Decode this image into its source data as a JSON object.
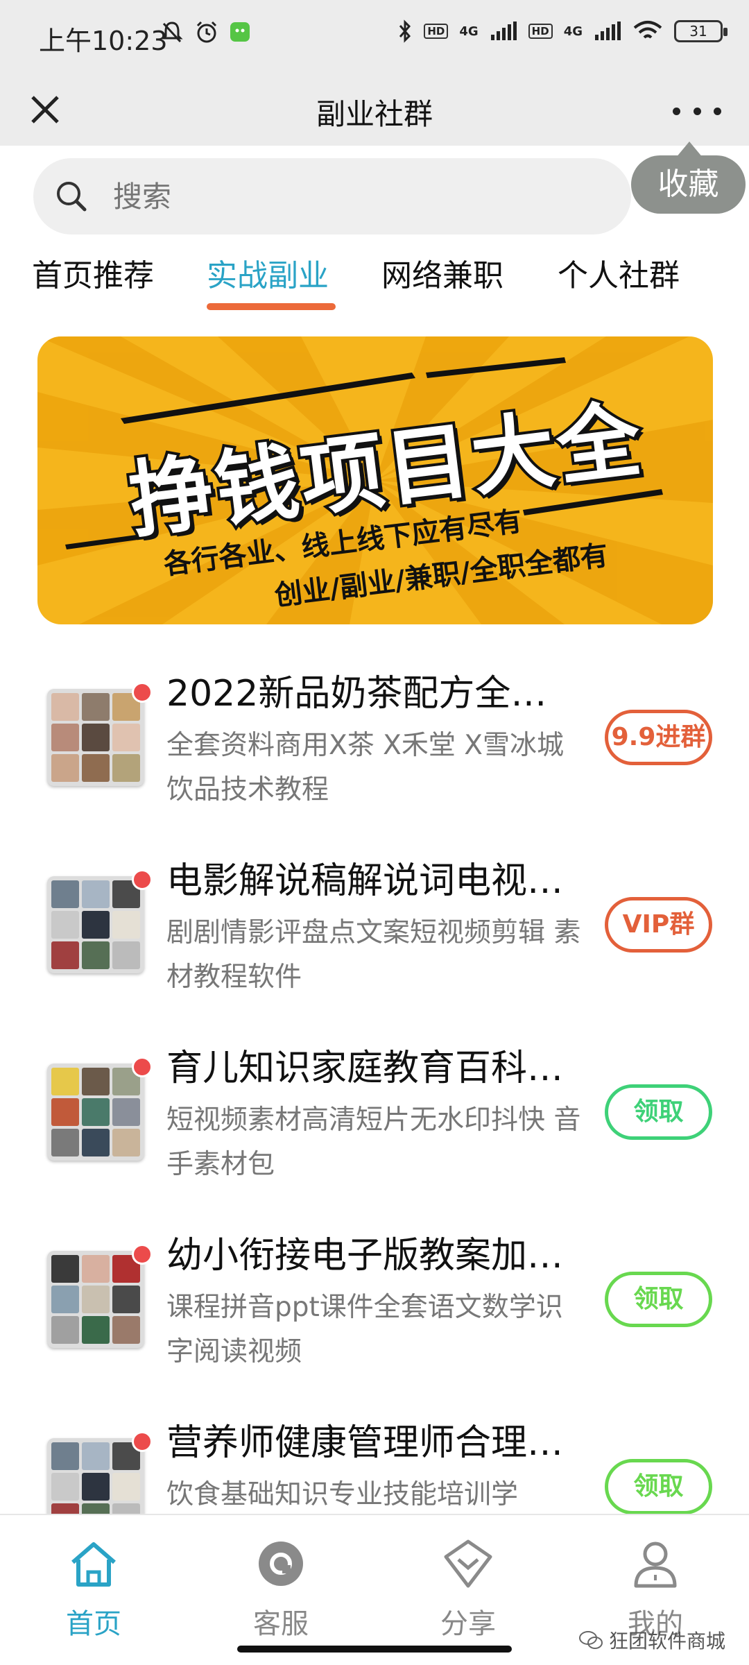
{
  "status_bar": {
    "time": "上午10:23",
    "network_1": "4G",
    "network_2": "4G",
    "hd_1": "HD",
    "hd_2": "HD",
    "battery": "31"
  },
  "header": {
    "title": "副业社群",
    "close_icon": "close-icon",
    "more_icon": "more-icon"
  },
  "search": {
    "placeholder": "搜索",
    "favorite_label": "收藏"
  },
  "tabs": [
    {
      "label": "首页推荐",
      "active": false
    },
    {
      "label": "实战副业",
      "active": true
    },
    {
      "label": "网络兼职",
      "active": false
    },
    {
      "label": "个人社群",
      "active": false
    }
  ],
  "banner": {
    "title": "挣钱项目大全",
    "subtitle_1": "各行各业、线上线下应有尽有",
    "subtitle_2": "创业/副业/兼职/全职全都有"
  },
  "items": [
    {
      "title": "2022新品奶茶配方全…",
      "desc": "全套资料商用X茶 X禾堂 X雪冰城饮品技术教程",
      "button": "9.9进群"
    },
    {
      "title": "电影解说稿解说词电视…",
      "desc": "剧剧情影评盘点文案短视频剪辑 素材教程软件",
      "button": "VIP群"
    },
    {
      "title": "育儿知识家庭教育百科…",
      "desc": "短视频素材高清短片无水印抖快 音手素材包",
      "button": "领取"
    },
    {
      "title": "幼小衔接电子版教案加…",
      "desc": "课程拼音ppt课件全套语文数学识 字阅读视频",
      "button": "领取"
    },
    {
      "title": "营养师健康管理师合理…",
      "desc": "饮食基础知识专业技能培训学",
      "button": "领取"
    }
  ],
  "bottom_nav": [
    {
      "label": "首页",
      "icon": "home-icon",
      "active": true
    },
    {
      "label": "客服",
      "icon": "service-icon",
      "active": false
    },
    {
      "label": "分享",
      "icon": "share-icon",
      "active": false
    },
    {
      "label": "我的",
      "icon": "profile-icon",
      "active": false
    }
  ],
  "watermark": "狂团软件商城",
  "colors": {
    "accent_blue": "#2aa3c6",
    "accent_orange": "#e3603a",
    "accent_green": "#3ed178",
    "banner_yellow": "#f5b51c"
  }
}
